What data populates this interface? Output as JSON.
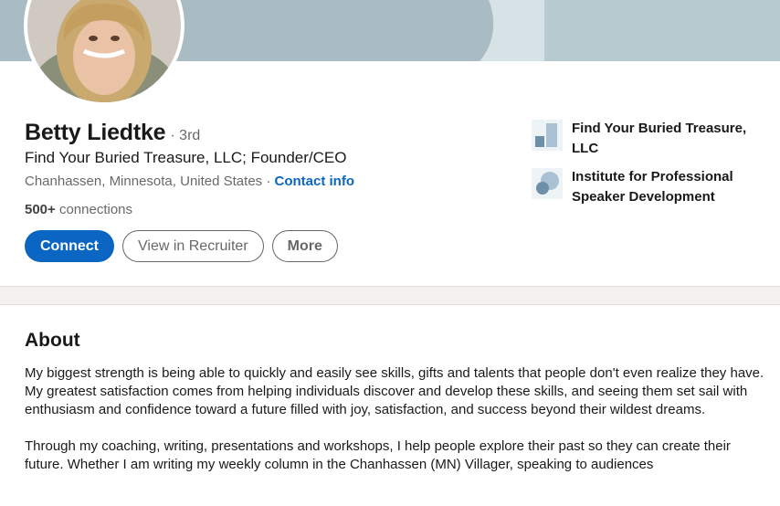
{
  "profile": {
    "name": "Betty Liedtke",
    "degree": "· 3rd",
    "headline": "Find Your Buried Treasure, LLC; Founder/CEO",
    "location": "Chanhassen, Minnesota, United States",
    "location_separator": " · ",
    "contact_info_label": "Contact info",
    "connections_count": "500+",
    "connections_label": " connections"
  },
  "actions": {
    "connect_label": "Connect",
    "recruiter_label": "View in Recruiter",
    "more_label": "More"
  },
  "organizations": [
    {
      "name": "Find Your Buried Treasure, LLC",
      "icon": "company-logo-icon"
    },
    {
      "name": "Institute for Professional Speaker Development",
      "icon": "school-logo-icon"
    }
  ],
  "about": {
    "title": "About",
    "paragraphs": [
      "My biggest strength is being able to quickly and easily see skills, gifts and talents that people don't even realize they have. My greatest satisfaction comes from helping individuals discover and develop these skills, and seeing them set sail with enthusiasm and confidence toward a future filled with joy, satisfaction, and success beyond their wildest dreams.",
      "Through my coaching, writing, presentations and workshops, I help people explore their past so they can create their future. Whether I am writing my weekly column in the Chanhassen (MN) Villager, speaking to audiences"
    ]
  },
  "colors": {
    "accent": "#0a66c2",
    "banner": "#a9bcc3",
    "page_background": "#f3f2ef"
  }
}
